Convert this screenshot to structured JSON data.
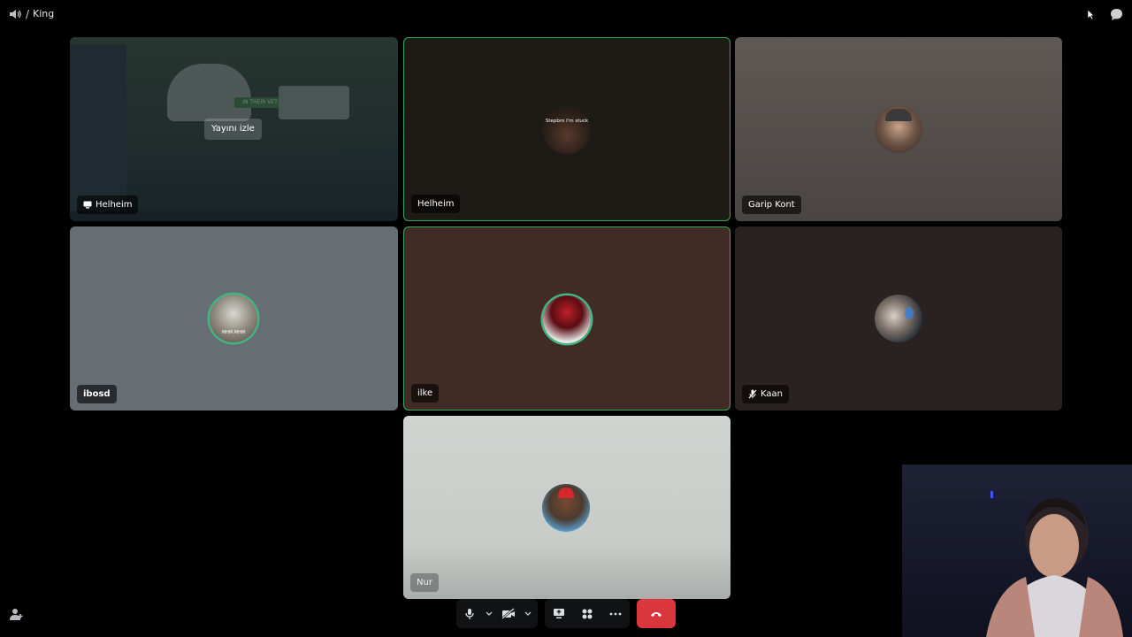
{
  "header": {
    "separator": "/",
    "channel_name": "King"
  },
  "tiles": [
    {
      "name": "Helheim",
      "watch_label": "Yayını izle",
      "stream_preview_text": "IN THEIR VET"
    },
    {
      "name": "Helheim",
      "avatar_caption": "Stepbro I'm stuck"
    },
    {
      "name": "Garip Kont"
    },
    {
      "name": "ibosd",
      "avatar_caption": "MHM MHM"
    },
    {
      "name": "ilke"
    },
    {
      "name": "Kaan"
    },
    {
      "name": "Nur"
    }
  ],
  "controls": {
    "microphone": "microphone-icon",
    "camera": "camera-off-icon",
    "screen_share": "screen-share-icon",
    "activities": "activities-icon",
    "more": "more-icon",
    "disconnect": "hang-up-icon"
  },
  "colors": {
    "speaking_border": "#3ba55d",
    "hangup_red": "#da373c",
    "background": "#000000"
  }
}
